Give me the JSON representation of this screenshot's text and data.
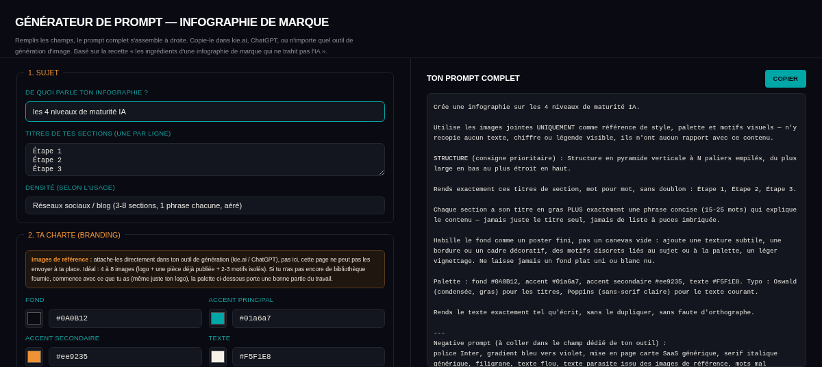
{
  "header": {
    "title": "GÉNÉRATEUR DE PROMPT — INFOGRAPHIE DE MARQUE",
    "subtitle": "Remplis les champs, le prompt complet s'assemble à droite. Copie-le dans kie.ai, ChatGPT, ou n'importe quel outil de génération d'image. Basé sur la recette « les ingrédients d'une infographie de marque qui ne trahit pas l'IA »."
  },
  "sections": [
    {
      "legend": "1. SUJET",
      "fields": [
        {
          "kind": "text",
          "label": "DE QUOI PARLE TON INFOGRAPHIE ?",
          "value": "les 4 niveaux de maturité IA",
          "focused": true
        },
        {
          "kind": "textarea",
          "label": "TITRES DE TES SECTIONS (UNE PAR LIGNE)",
          "lines": [
            "Étape 1",
            "Étape 2",
            "Étape 3"
          ],
          "focused": false
        },
        {
          "kind": "select",
          "label": "DENSITÉ (SELON L'USAGE)",
          "value": "Réseaux sociaux / blog (3-8 sections, 1 phrase chacune, aéré)",
          "focused": false
        }
      ]
    },
    {
      "legend": "2. TA CHARTE (BRANDING)",
      "notice": "**Images de référence :** attache-les directement dans ton outil de génération (kie.ai / ChatGPT), pas ici, cette page ne peut pas les envoyer à ta place. Idéal : 4 à 8 images (logo + une pièce déjà publiée + 2-3 motifs isolés). Si tu n'as pas encore de bibliothèque fournie, commence avec ce que tu as (même juste ton logo), la palette ci-dessous porte une bonne partie du travail.",
      "colors": [
        {
          "label": "FOND",
          "value": "#0A0B12",
          "color": "#0a0b12"
        },
        {
          "label": "ACCENT PRINCIPAL",
          "value": "#01a6a7",
          "color": "#01a6a7"
        },
        {
          "label": "ACCENT SECONDAIRE",
          "value": "#ee9235",
          "color": "#ee9235"
        },
        {
          "label": "TEXTE",
          "value": "#F5F1E8",
          "color": "#f5f1e8"
        }
      ]
    }
  ],
  "output": {
    "title": "TON PROMPT COMPLET",
    "button": "COPIER",
    "paragraphs": [
      "Crée une infographie sur les 4 niveaux de maturité IA.",
      "Utilise les images jointes UNIQUEMENT comme référence de style, palette et motifs visuels — n'y recopie aucun texte, chiffre ou légende visible, ils n'ont aucun rapport avec ce contenu.",
      "STRUCTURE (consigne prioritaire) : Structure en pyramide verticale à N paliers empilés, du plus large en bas au plus étroit en haut.",
      "Rends exactement ces titres de section, mot pour mot, sans doublon : Étape 1, Étape 2, Étape 3.",
      "Chaque section a son titre en gras PLUS exactement une phrase concise (15-25 mots) qui explique le contenu — jamais juste le titre seul, jamais de liste à puces imbriquée.",
      "Habille le fond comme un poster fini, pas un canevas vide : ajoute une texture subtile, une bordure ou un cadre décoratif, des motifs discrets liés au sujet ou à la palette, un léger vignettage. Ne laisse jamais un fond plat uni ou blanc nu.",
      "Palette : fond #0A0B12, accent #01a6a7, accent secondaire #ee9235, texte #F5F1E8. Typo : Oswald (condensée, gras) pour les titres, Poppins (sans-serif claire) pour le texte courant.",
      "Rends le texte exactement tel qu'écrit, sans le dupliquer, sans faute d'orthographe.",
      "---\nNegative prompt (à coller dans le champ dédié de ton outil) :\npolice Inter, gradient bleu vers violet, mise en page carte SaaS générique, serif italique générique, filigrane, texte flou, texte parasite issu des images de référence, mots mal"
    ]
  }
}
